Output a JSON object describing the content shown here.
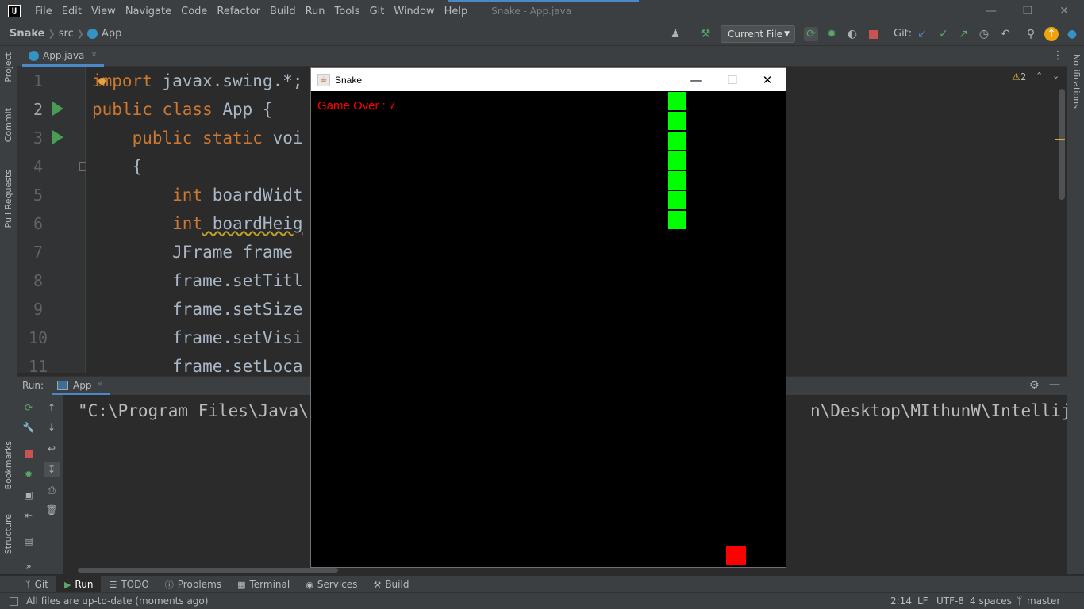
{
  "menubar": {
    "logo": "IJ",
    "items": [
      "File",
      "Edit",
      "View",
      "Navigate",
      "Code",
      "Refactor",
      "Build",
      "Run",
      "Tools",
      "Git",
      "Window",
      "Help"
    ],
    "title": "Snake - App.java"
  },
  "navbar": {
    "crumbs": [
      "Snake",
      "src",
      "App"
    ],
    "run_config": "Current File",
    "git_label": "Git:"
  },
  "left_strip": {
    "project": "Project",
    "commit": "Commit",
    "pull_requests": "Pull Requests",
    "bookmarks": "Bookmarks",
    "structure": "Structure"
  },
  "right_strip": {
    "notifications": "Notifications"
  },
  "editor": {
    "tab": "App.java",
    "warnings": "2",
    "line_numbers": [
      "1",
      "2",
      "3",
      "4",
      "5",
      "6",
      "7",
      "8",
      "9",
      "10",
      "11"
    ],
    "lines": [
      {
        "kw": "import",
        "rest": " javax.swing.*;"
      },
      {
        "kw": "public class",
        "rest": " App {"
      },
      {
        "kw": "    public static",
        "rest": " voi"
      },
      {
        "kw": "",
        "rest": "    {"
      },
      {
        "kw": "        int",
        "rest": " boardWidt"
      },
      {
        "kw": "        int",
        "rest": " boardHeig"
      },
      {
        "kw": "",
        "rest": "        JFrame frame "
      },
      {
        "kw": "",
        "rest": "        frame.setTitl"
      },
      {
        "kw": "",
        "rest": "        frame.setSize"
      },
      {
        "kw": "",
        "rest": "        frame.setVisi"
      },
      {
        "kw": "",
        "rest": "        frame.setLoca"
      }
    ]
  },
  "run_panel": {
    "label": "Run:",
    "tab": "App",
    "console_line": "\"C:\\Program Files\\Java\\                                                  n\\Desktop\\MIthunW\\Intellij"
  },
  "bottom_tabs": [
    {
      "label": "Git",
      "icon": "git-icon"
    },
    {
      "label": "Run",
      "icon": "run-icon",
      "active": true
    },
    {
      "label": "TODO",
      "icon": "todo-icon"
    },
    {
      "label": "Problems",
      "icon": "problems-icon"
    },
    {
      "label": "Terminal",
      "icon": "terminal-icon"
    },
    {
      "label": "Services",
      "icon": "services-icon"
    },
    {
      "label": "Build",
      "icon": "build-icon"
    }
  ],
  "statusbar": {
    "message": "All files are up-to-date (moments ago)",
    "position": "2:14",
    "line_sep": "LF",
    "encoding": "UTF-8",
    "indent": "4 spaces",
    "branch": "master"
  },
  "snake_window": {
    "title": "Snake",
    "game_over": "Game Over : 7",
    "colors": {
      "board": "#000000",
      "snake": "#00ff00",
      "food": "#ff0000",
      "text": "#ff0000"
    },
    "grid_tiles": 24,
    "snake_cells": [
      [
        18,
        0
      ],
      [
        18,
        1
      ],
      [
        18,
        2
      ],
      [
        18,
        3
      ],
      [
        18,
        4
      ],
      [
        18,
        5
      ],
      [
        18,
        6
      ]
    ],
    "food_cell": [
      21,
      23
    ]
  }
}
